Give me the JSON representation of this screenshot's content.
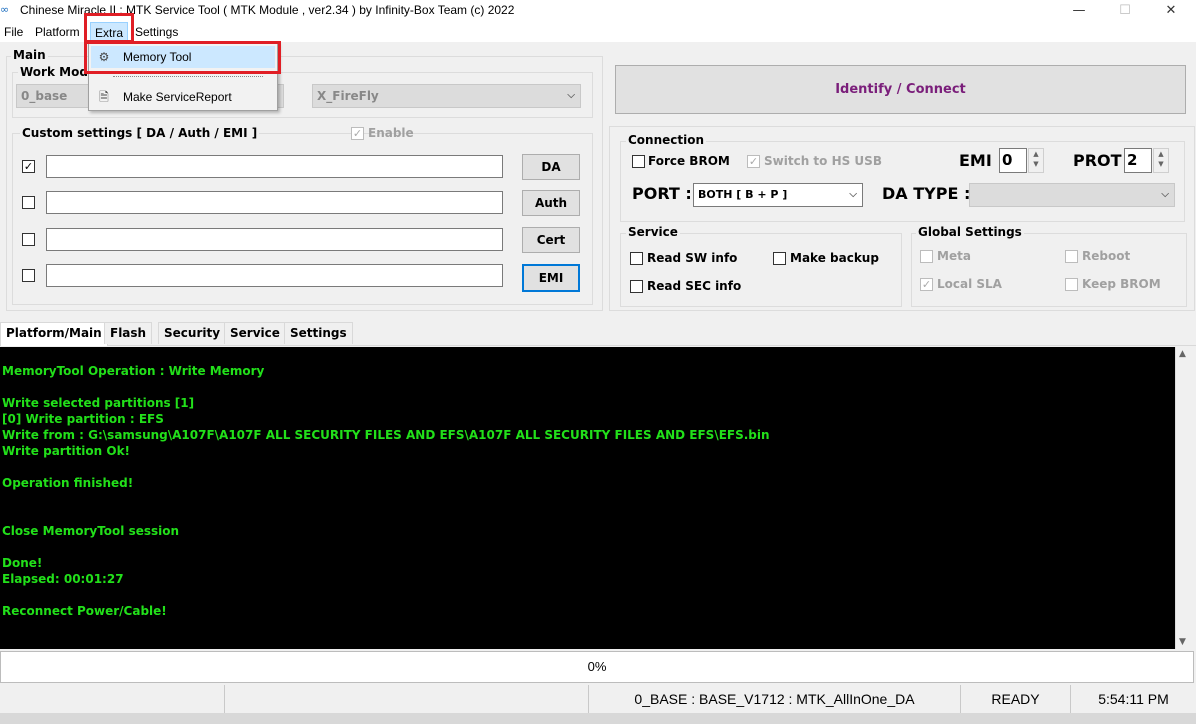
{
  "window": {
    "title": "Chinese Miracle II : MTK Service Tool ( MTK Module , ver2.34  ) by Infinity-Box Team (c) 2022",
    "minimize": "—",
    "maximize": "☐",
    "close": "✕"
  },
  "menu": {
    "file": "File",
    "platform": "Platform",
    "extra": "Extra",
    "settings": "Settings"
  },
  "extra_menu": {
    "items": [
      {
        "label": "Memory Tool",
        "icon": "gear-wrench-icon"
      },
      {
        "label": "Make ServiceReport",
        "icon": "report-icon"
      }
    ]
  },
  "main_group": {
    "label": "Main",
    "work_mode_label": "Work Mode",
    "work_mode_value": "0_base",
    "platform_value": "X_FireFly"
  },
  "custom_settings": {
    "label": "Custom settings [ DA / Auth / EMI ]",
    "enable_label": "Enable",
    "enable_checked": true,
    "rows": [
      {
        "checked": true,
        "value": "",
        "button": "DA"
      },
      {
        "checked": false,
        "value": "",
        "button": "Auth"
      },
      {
        "checked": false,
        "value": "",
        "button": "Cert"
      },
      {
        "checked": false,
        "value": "",
        "button": "EMI"
      }
    ]
  },
  "identify_button": "Identify / Connect",
  "connection": {
    "label": "Connection",
    "force_brom": "Force BROM",
    "force_brom_checked": false,
    "switch_hs": "Switch to HS USB",
    "switch_hs_checked": true,
    "emi_label": "EMI :",
    "emi_value": "0",
    "prot_label": "PROT",
    "prot_value": "2",
    "port_label": "PORT :",
    "port_value": "BOTH [ B + P ]",
    "da_type_label": "DA TYPE :",
    "da_type_value": ""
  },
  "service": {
    "label": "Service",
    "read_sw": "Read SW info",
    "make_backup": "Make backup",
    "read_sec": "Read SEC info"
  },
  "global_settings": {
    "label": "Global Settings",
    "meta": "Meta",
    "reboot": "Reboot",
    "local_sla": "Local SLA",
    "local_sla_checked": true,
    "keep_brom": "Keep BROM"
  },
  "tabs": [
    "Platform/Main",
    "Flash",
    "Security",
    "Service",
    "Settings"
  ],
  "console": {
    "lines": [
      "MemoryTool Operation : Write Memory",
      "",
      "Write selected partitions [1]",
      "[0] Write partition : EFS",
      "Write from : G:\\samsung\\A107F\\A107F ALL SECURITY FILES AND EFS\\A107F ALL SECURITY FILES AND EFS\\EFS.bin",
      "Write partition Ok!",
      "",
      "Operation finished!",
      "",
      "",
      "Close MemoryTool session",
      "",
      "Done!",
      "Elapsed: 00:01:27",
      "",
      "Reconnect Power/Cable!"
    ]
  },
  "progress": {
    "text": "0%",
    "value": 0
  },
  "status": {
    "info": "0_BASE : BASE_V1712 : MTK_AllInOne_DA",
    "state": "READY",
    "time": "5:54:11 PM"
  },
  "colors": {
    "console_text": "#22e01a",
    "identify_text": "#7a1e7a",
    "highlight": "#e01e25",
    "focus_border": "#0078d7"
  }
}
